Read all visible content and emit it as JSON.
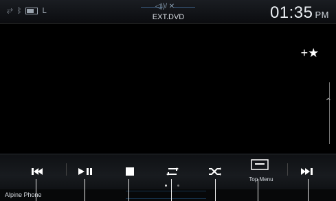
{
  "status": {
    "icons": [
      "link-icon",
      "bluetooth-icon",
      "battery-icon",
      "signal-icon"
    ],
    "audio_indicator": "◁))/ ✕",
    "source": "EXT.DVD",
    "time": "01:35",
    "ampm": "PM"
  },
  "controls": [
    {
      "name": "previous",
      "symbol": "⏮"
    },
    {
      "name": "play-pause",
      "symbol": "⏯"
    },
    {
      "name": "stop",
      "symbol": "■"
    },
    {
      "name": "repeat",
      "symbol": "🔁"
    },
    {
      "name": "shuffle",
      "symbol": "🔀"
    },
    {
      "name": "top-menu",
      "symbol": "☰"
    },
    {
      "name": "next",
      "symbol": "⏭"
    }
  ],
  "top_menu_label": "Top Menu",
  "bottom": {
    "left_label": "Alpine Phone"
  },
  "favorite_label": "+★"
}
